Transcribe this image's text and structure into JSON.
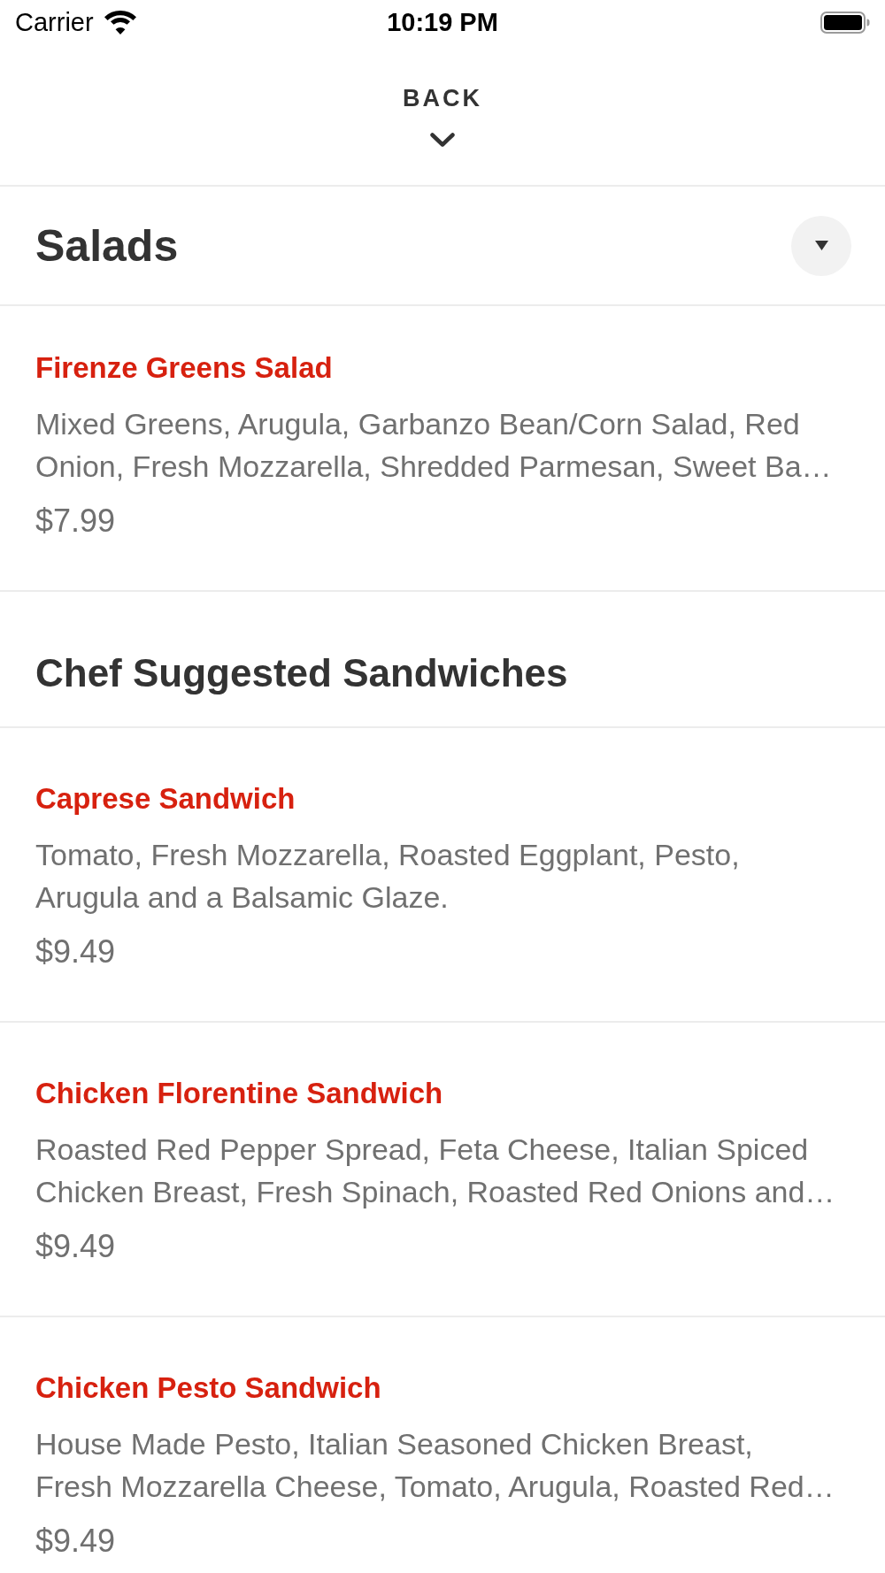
{
  "status_bar": {
    "carrier": "Carrier",
    "time": "10:19 PM"
  },
  "header": {
    "back_label": "BACK"
  },
  "category_header": {
    "title": "Salads"
  },
  "sections": [
    {
      "items": [
        {
          "name": "Firenze Greens Salad",
          "description": "Mixed Greens, Arugula, Garbanzo Bean/Corn Salad, Red Onion, Fresh Mozzarella, Shredded Parmesan, Sweet Ba…",
          "price": "$7.99"
        }
      ]
    },
    {
      "title": "Chef Suggested Sandwiches",
      "items": [
        {
          "name": "Caprese Sandwich",
          "description": "Tomato, Fresh Mozzarella, Roasted Eggplant, Pesto, Arugula and a Balsamic Glaze.",
          "price": "$9.49"
        },
        {
          "name": "Chicken Florentine Sandwich",
          "description": "Roasted Red Pepper Spread, Feta Cheese, Italian Spiced Chicken Breast, Fresh Spinach, Roasted Red Onions and…",
          "price": "$9.49"
        },
        {
          "name": "Chicken Pesto Sandwich",
          "description": "House Made Pesto, Italian Seasoned Chicken Breast, Fresh Mozzarella Cheese, Tomato, Arugula, Roasted Red…",
          "price": "$9.49"
        }
      ]
    }
  ]
}
